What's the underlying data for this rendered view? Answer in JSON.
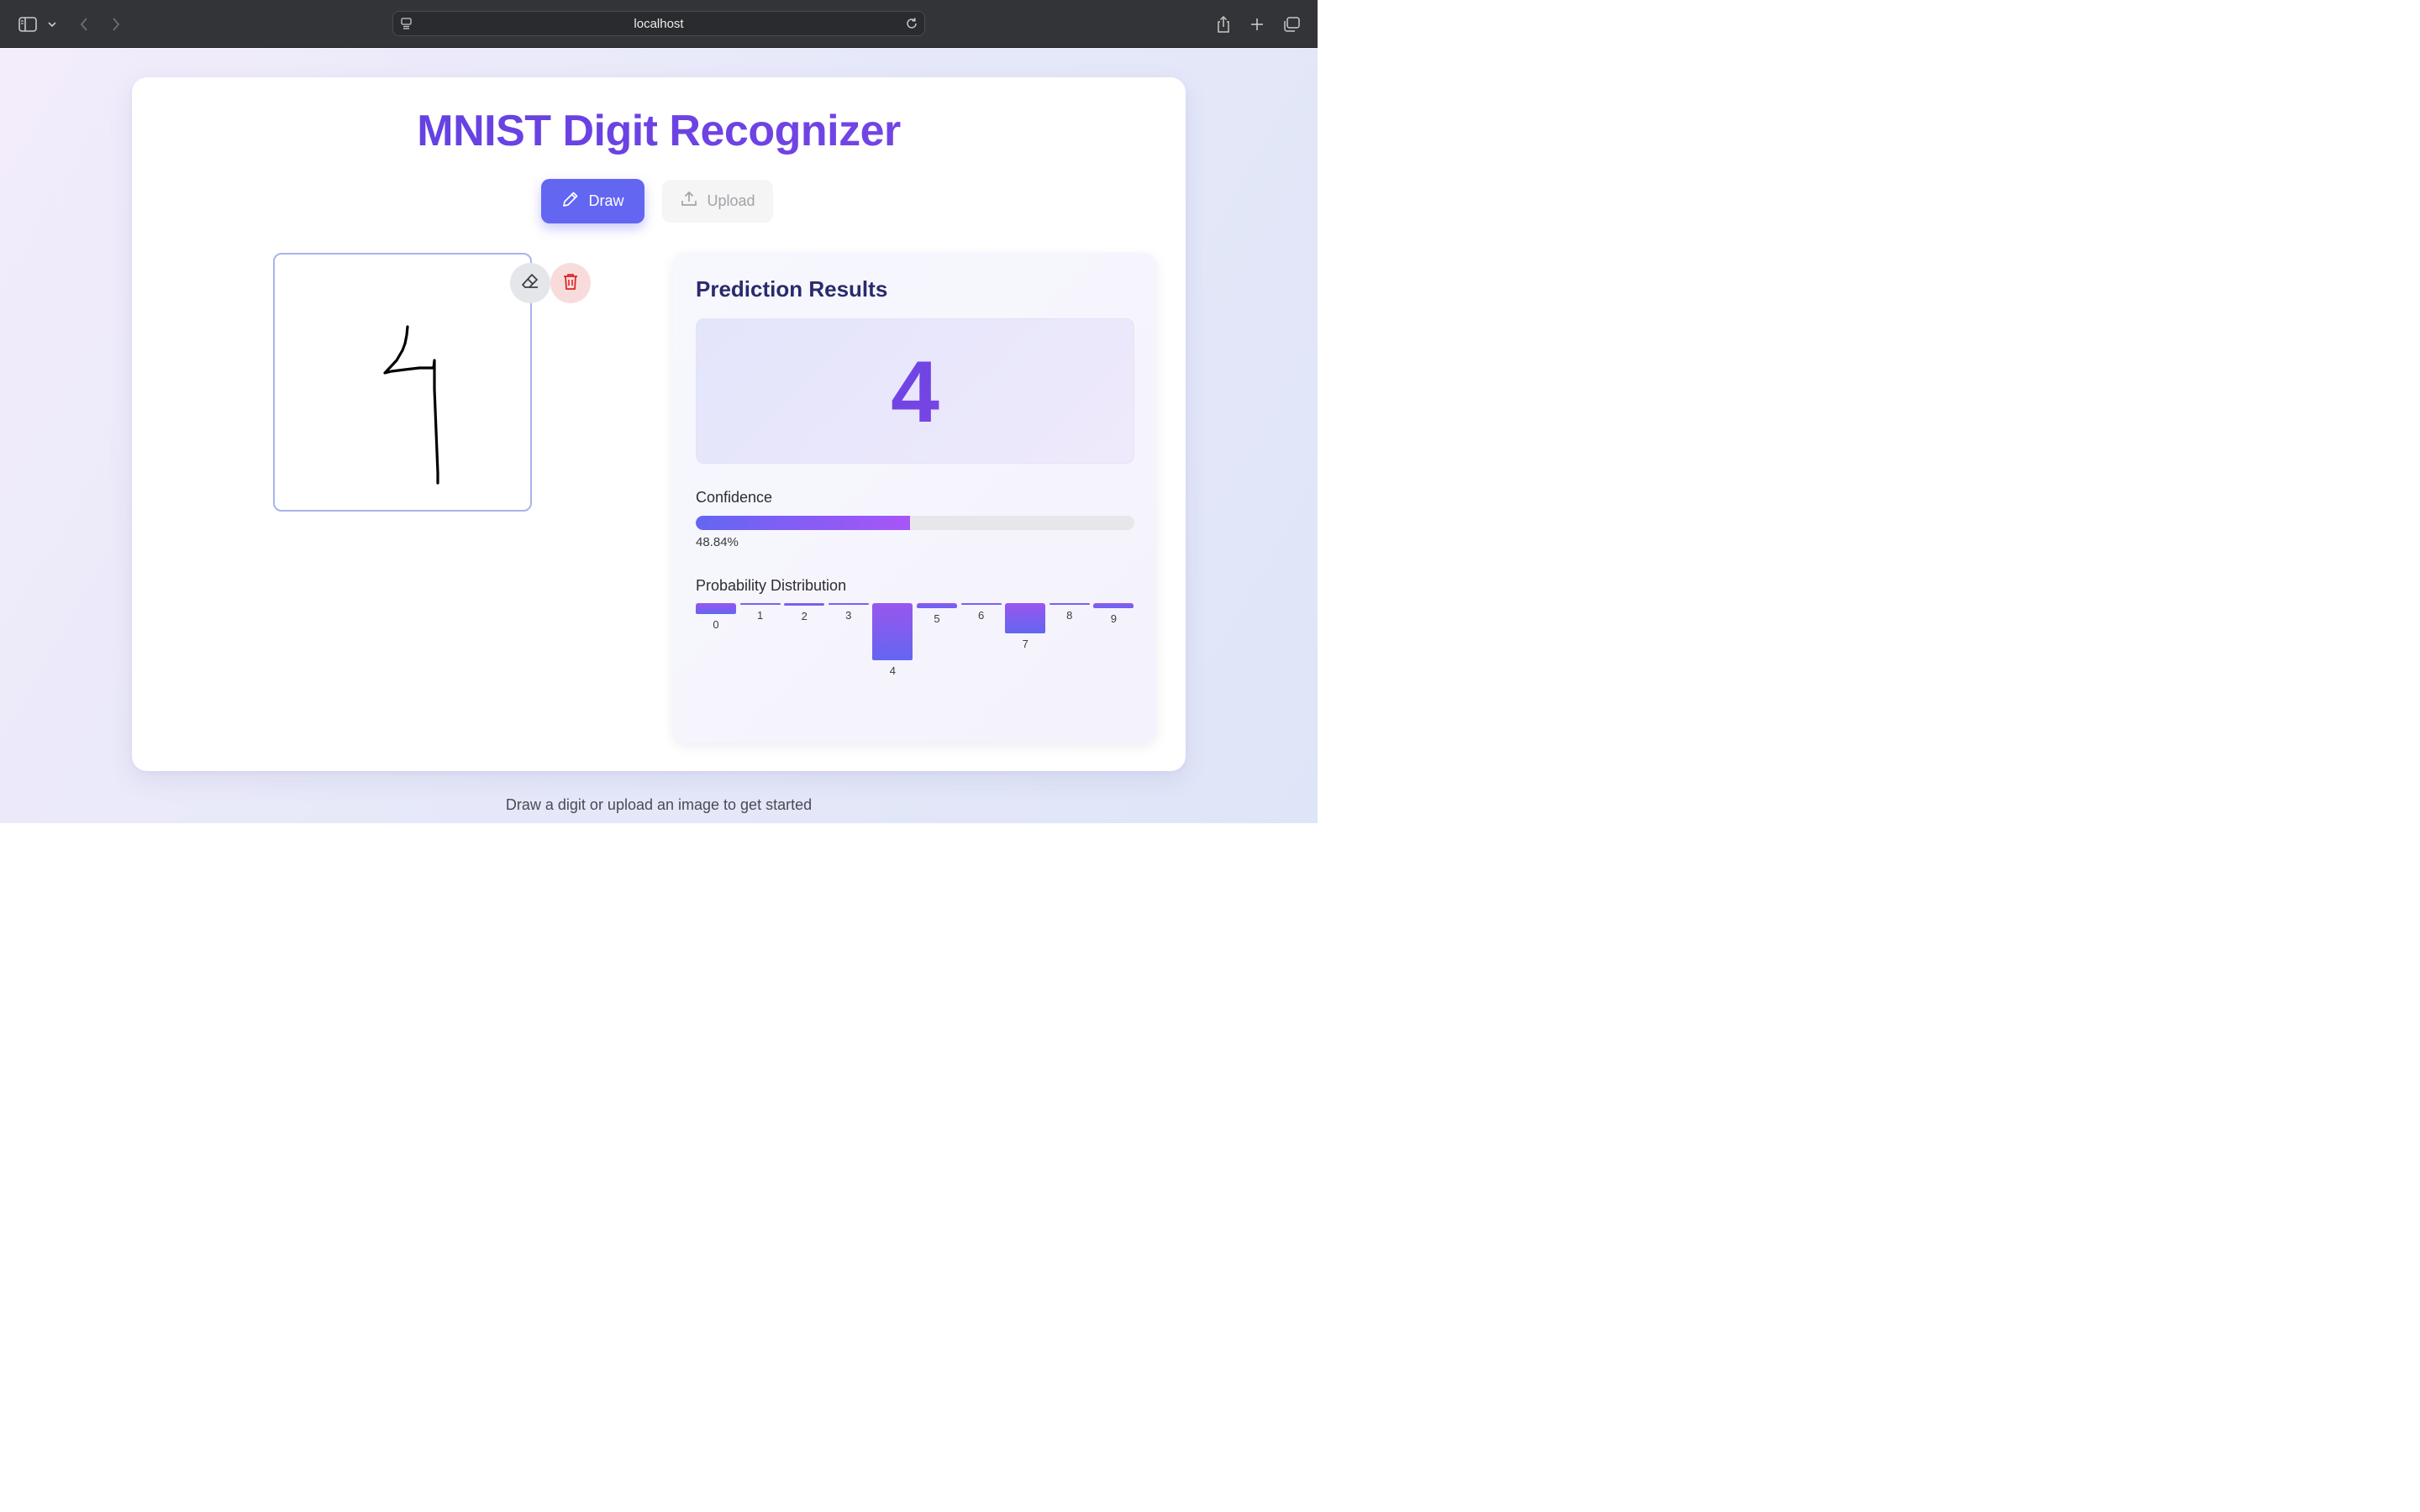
{
  "browser": {
    "address": "localhost"
  },
  "app": {
    "title": "MNIST Digit Recognizer",
    "modes": {
      "draw_label": "Draw",
      "upload_label": "Upload",
      "active": "Draw"
    }
  },
  "canvas": {
    "drawn_digit": "4",
    "tools": [
      "eraser-icon",
      "trash-icon"
    ]
  },
  "results": {
    "title": "Prediction Results",
    "predicted_digit": "4",
    "confidence_label": "Confidence",
    "confidence_value": "48.84%",
    "confidence_fraction": 0.4884,
    "distribution_label": "Probability Distribution"
  },
  "chart_data": {
    "type": "bar",
    "categories": [
      "0",
      "1",
      "2",
      "3",
      "4",
      "5",
      "6",
      "7",
      "8",
      "9"
    ],
    "values": [
      0.092,
      0.007,
      0.02,
      0.007,
      0.4884,
      0.04,
      0.015,
      0.255,
      0.003,
      0.04
    ]
  },
  "footer": {
    "hint": "Draw a digit or upload an image to get started"
  },
  "colors": {
    "accent": "#6366f1",
    "accent_purple": "#a855f7",
    "danger_bg": "#f8dcdc",
    "title_dark": "#2b2a6b"
  }
}
